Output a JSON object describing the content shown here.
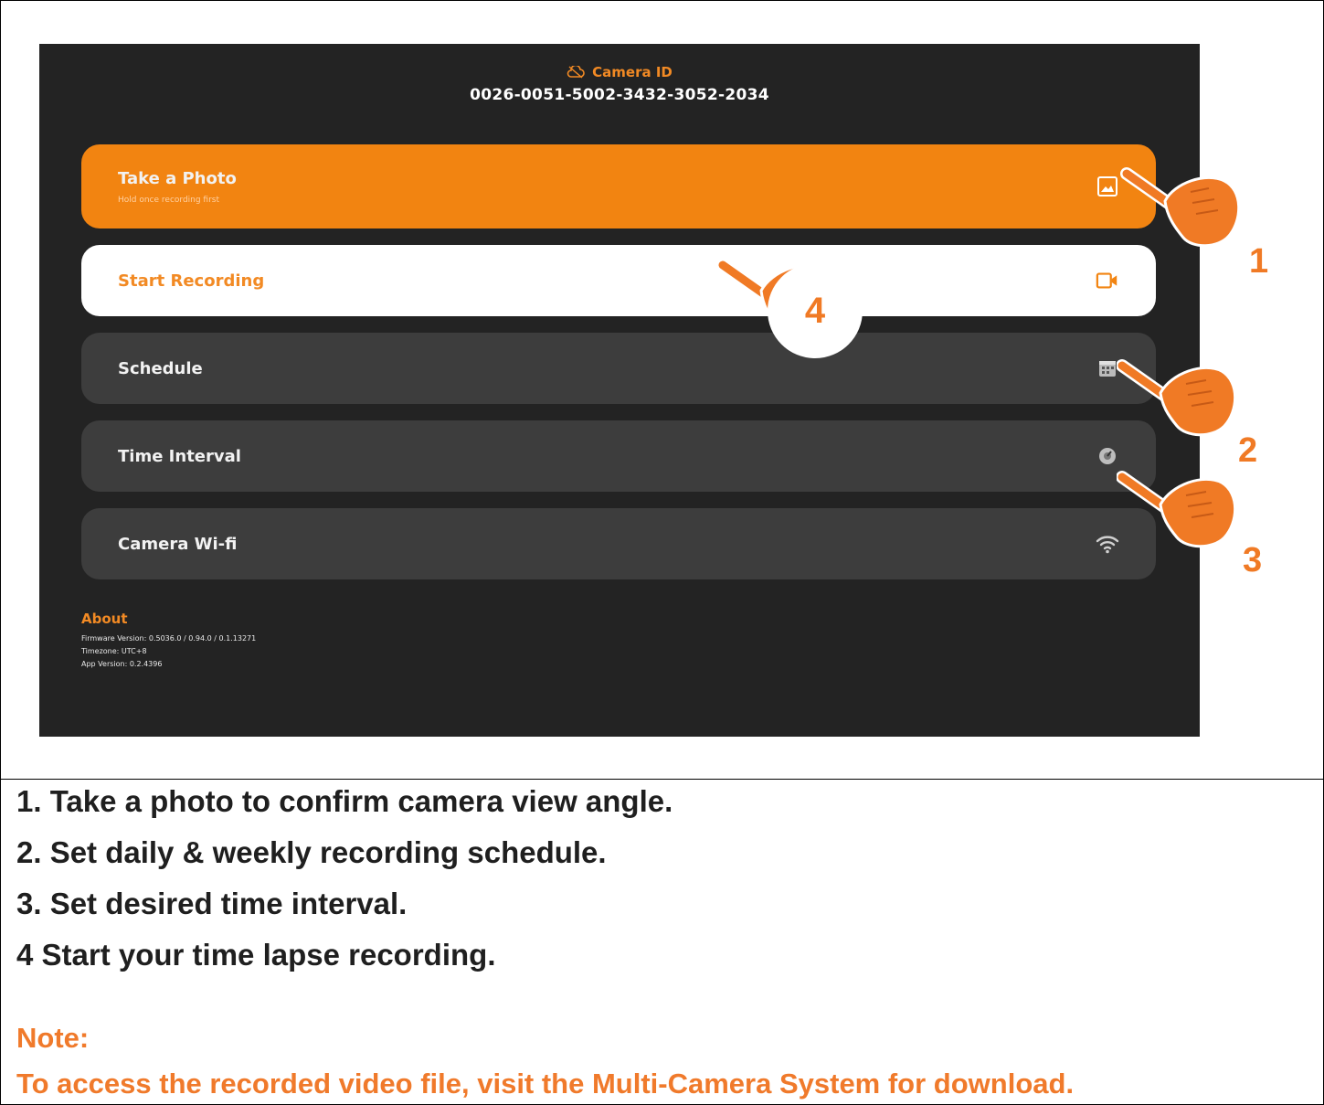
{
  "camera": {
    "title": "Camera ID",
    "id": "0026-0051-5002-3432-3052-2034"
  },
  "menu": [
    {
      "label": "Take a Photo",
      "sub": "Hold once recording first"
    },
    {
      "label": "Start Recording"
    },
    {
      "label": "Schedule"
    },
    {
      "label": "Time Interval"
    },
    {
      "label": "Camera Wi-fi"
    }
  ],
  "about": {
    "title": "About",
    "firmware": "Firmware Version: 0.5036.0 / 0.94.0 / 0.1.13271",
    "timezone": "Timezone: UTC+8",
    "app_version": "App Version: 0.2.4396"
  },
  "callouts": [
    "1",
    "2",
    "3",
    "4"
  ],
  "instructions": [
    "1. Take a photo to confirm camera view angle.",
    "2. Set daily & weekly recording schedule.",
    "3. Set desired time interval.",
    "4 Start your time lapse recording."
  ],
  "note": {
    "title": "Note:",
    "text": "To access the recorded video file, visit the Multi-Camera System for download."
  },
  "colors": {
    "accent": "#f28411",
    "background": "#232323",
    "row": "#3d3d3d"
  }
}
